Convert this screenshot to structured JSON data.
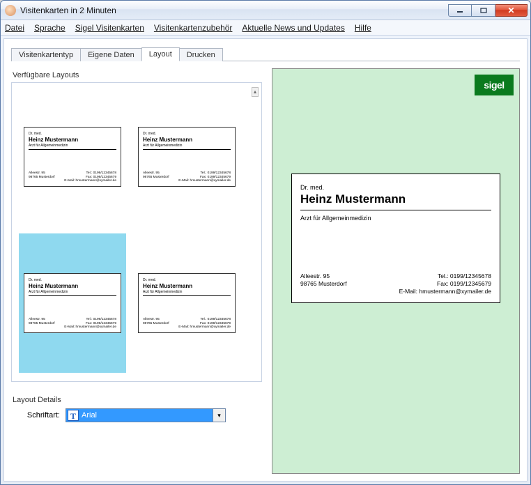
{
  "window": {
    "title": "Visitenkarten in 2 Minuten"
  },
  "menu": {
    "items": [
      "Datei",
      "Sprache",
      "Sigel Visitenkarten",
      "Visitenkartenzubehör",
      "Aktuelle News und Updates",
      "Hilfe"
    ]
  },
  "tabs": {
    "items": [
      "Visitenkartentyp",
      "Eigene Daten",
      "Layout",
      "Drucken"
    ],
    "active_index": 2
  },
  "layouts": {
    "section_label": "Verfügbare Layouts",
    "selected_index": 2
  },
  "details": {
    "section_label": "Layout Details",
    "font_label": "Schriftart:",
    "font_value": "Arial"
  },
  "brand": {
    "label": "sigel"
  },
  "card": {
    "prefix": "Dr. med.",
    "name": "Heinz Mustermann",
    "subtitle": "Arzt für Allgemeinmedizin",
    "address1": "Alleestr. 95",
    "address2": "98765 Musterdorf",
    "tel": "Tel.: 0199/12345678",
    "fax": "Fax: 0199/12345679",
    "email": "E-Mail: hmustermann@xymailer.de"
  },
  "mini": {
    "prefix": "Dr. med.",
    "name": "Heinz Mustermann",
    "subtitle": "Arzt für Allgemeinmedizin",
    "addr1": "Alleestr. 95",
    "addr2": "98765 Musterdorf",
    "t1": "Tel.: 0199/12345678",
    "t2": "Fax: 0199/12345679",
    "t3": "E-Mail: hmustermann@xymailer.de"
  }
}
